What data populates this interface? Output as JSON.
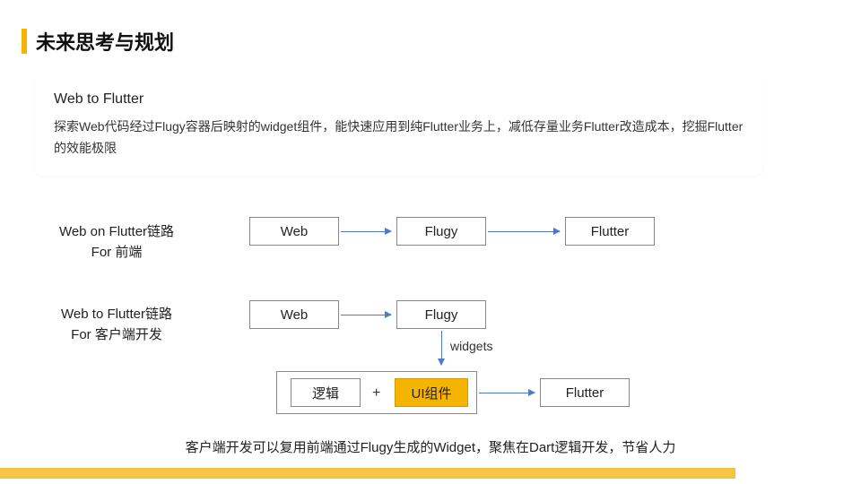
{
  "title": "未来思考与规划",
  "card": {
    "title": "Web to Flutter",
    "body": "探索Web代码经过Flugy容器后映射的widget组件，能快速应用到纯Flutter业务上，减低存量业务Flutter改造成本，挖掘Flutter的效能极限"
  },
  "rows": {
    "row1": {
      "label1": "Web on Flutter链路",
      "label2": "For 前端"
    },
    "row2": {
      "label1": "Web to Flutter链路",
      "label2": "For 客户端开发"
    }
  },
  "nodes": {
    "web": "Web",
    "flugy": "Flugy",
    "flutter": "Flutter",
    "logic": "逻辑",
    "ui": "UI组件"
  },
  "labels": {
    "plus": "+",
    "widgets": "widgets"
  },
  "footer": "客户端开发可以复用前端通过Flugy生成的Widget，聚焦在Dart逻辑开发，节省人力"
}
